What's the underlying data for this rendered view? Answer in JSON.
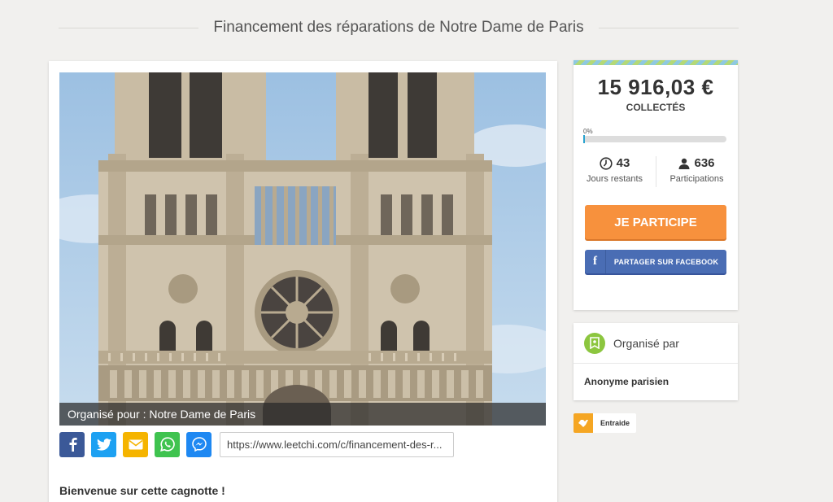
{
  "page": {
    "title": "Financement des réparations de Notre Dame de Paris"
  },
  "main": {
    "photo_caption": "Organisé pour : Notre Dame de Paris",
    "share": {
      "url": "https://www.leetchi.com/c/financement-des-r..."
    },
    "welcome": "Bienvenue sur cette cagnotte !"
  },
  "stats": {
    "amount": "15 916,03 €",
    "collected_label": "COLLECTÉS",
    "progress_label": "0%",
    "progress_value": 0,
    "days_value": "43",
    "days_label": "Jours restants",
    "participants_value": "636",
    "participants_label": "Participations",
    "participate_button": "JE PARTICIPE",
    "facebook_button": "PARTAGER SUR FACEBOOK"
  },
  "organizer": {
    "heading": "Organisé par",
    "name": "Anonyme parisien"
  },
  "tag": {
    "label": "Entraide"
  },
  "colors": {
    "accent_orange": "#f7913d",
    "facebook_blue": "#4a6db4",
    "organizer_green": "#8cc63f",
    "progress_blue": "#29a3cf"
  },
  "icons": [
    "facebook-icon",
    "twitter-icon",
    "mail-icon",
    "whatsapp-icon",
    "messenger-icon",
    "clock-icon",
    "person-icon",
    "organizer-badge-icon",
    "handshake-icon"
  ]
}
